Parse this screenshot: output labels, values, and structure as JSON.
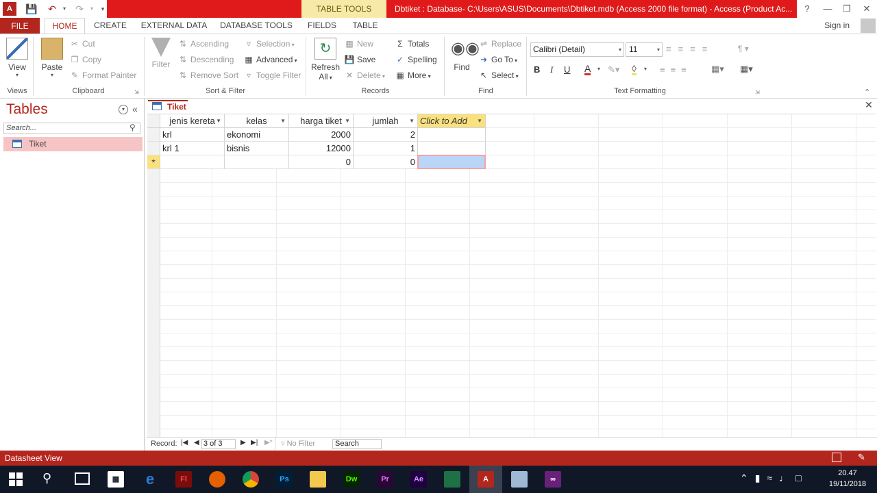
{
  "window": {
    "contextual_tab": "TABLE TOOLS",
    "title": "Dbtiket : Database- C:\\Users\\ASUS\\Documents\\Dbtiket.mdb (Access 2000 file format) -  Access (Product Ac...",
    "help": "?"
  },
  "tabs": {
    "file": "FILE",
    "home": "HOME",
    "create": "CREATE",
    "external": "EXTERNAL DATA",
    "dbtools": "DATABASE TOOLS",
    "fields": "FIELDS",
    "table": "TABLE",
    "sign_in": "Sign in"
  },
  "ribbon": {
    "views": {
      "view": "View",
      "group": "Views"
    },
    "clipboard": {
      "paste": "Paste",
      "cut": "Cut",
      "copy": "Copy",
      "format_painter": "Format Painter",
      "group": "Clipboard"
    },
    "sort_filter": {
      "filter": "Filter",
      "ascending": "Ascending",
      "descending": "Descending",
      "remove_sort": "Remove Sort",
      "selection": "Selection",
      "advanced": "Advanced",
      "toggle_filter": "Toggle Filter",
      "group": "Sort & Filter"
    },
    "records": {
      "refresh": "Refresh",
      "refresh2": "All",
      "new": "New",
      "save": "Save",
      "delete": "Delete",
      "totals": "Totals",
      "spelling": "Spelling",
      "more": "More",
      "group": "Records"
    },
    "find": {
      "find": "Find",
      "replace": "Replace",
      "goto": "Go To",
      "select": "Select",
      "group": "Find"
    },
    "text_formatting": {
      "font": "Calibri (Detail)",
      "size": "11",
      "bold": "B",
      "italic": "I",
      "underline": "U",
      "group": "Text Formatting"
    }
  },
  "nav": {
    "title": "Tables",
    "search_placeholder": "Search...",
    "items": [
      {
        "label": "Tiket"
      }
    ]
  },
  "document": {
    "tab": "Tiket",
    "columns": [
      "jenis kereta",
      "kelas",
      "harga tiket",
      "jumlah",
      "Click to Add"
    ],
    "rows": [
      {
        "jenis": "krl",
        "kelas": "ekonomi",
        "harga": "2000",
        "jumlah": "2"
      },
      {
        "jenis": "krl 1",
        "kelas": "bisnis",
        "harga": "12000",
        "jumlah": "1"
      }
    ],
    "new_row": {
      "marker": "*",
      "harga": "0",
      "jumlah": "0"
    }
  },
  "record_nav": {
    "label": "Record:",
    "position": "3 of 3",
    "filter": "No Filter",
    "search": "Search"
  },
  "status": {
    "text": "Datasheet View"
  },
  "taskbar": {
    "time": "20.47",
    "date": "19/11/2018"
  }
}
